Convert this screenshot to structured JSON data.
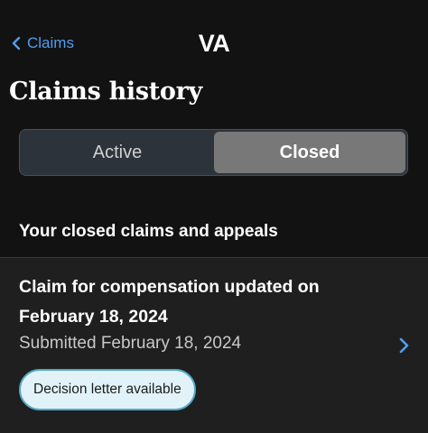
{
  "header": {
    "back_label": "Claims",
    "logo_text": "VA"
  },
  "page": {
    "title": "Claims history"
  },
  "tabs": [
    {
      "label": "Active",
      "selected": false
    },
    {
      "label": "Closed",
      "selected": true
    }
  ],
  "section": {
    "heading": "Your closed claims and appeals"
  },
  "claims": [
    {
      "title": "Claim for compensation updated on February 18, 2024",
      "submitted": "Submitted February 18, 2024",
      "badge": "Decision letter available"
    }
  ],
  "colors": {
    "background": "#121212",
    "link": "#4f9ef0",
    "selected_tab": "#787878",
    "card": "#1f1f1f",
    "badge_bg": "#e1f3f8",
    "badge_border": "#54a8c8"
  },
  "icons": {
    "back": "chevron-left-icon",
    "card_arrow": "chevron-right-icon"
  }
}
